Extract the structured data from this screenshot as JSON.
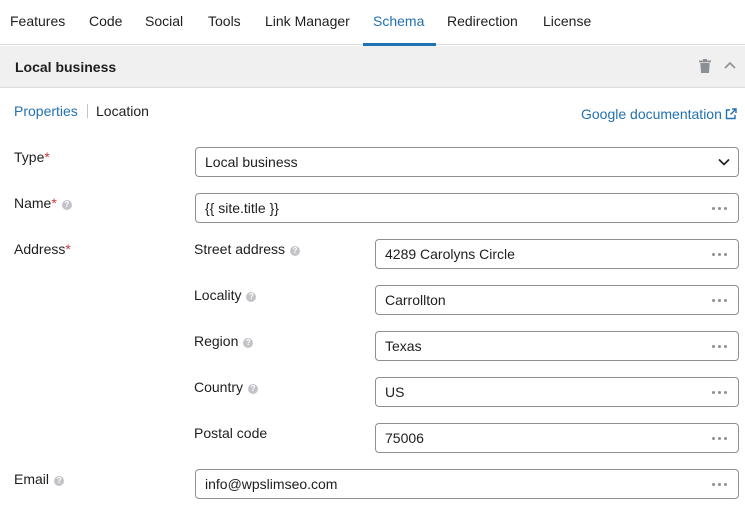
{
  "tabs": [
    "Features",
    "Code",
    "Social",
    "Tools",
    "Link Manager",
    "Schema",
    "Redirection",
    "License"
  ],
  "active_tab": "Schema",
  "panel": {
    "title": "Local business"
  },
  "subnav": {
    "properties": "Properties",
    "location": "Location",
    "google_doc": "Google documentation"
  },
  "form": {
    "type": {
      "label": "Type",
      "required": "*",
      "value": "Local business"
    },
    "name": {
      "label": "Name",
      "required": "*",
      "value": "{{ site.title }}"
    },
    "address": {
      "label": "Address",
      "required": "*",
      "street": {
        "label": "Street address",
        "value": "4289 Carolyns Circle"
      },
      "locality": {
        "label": "Locality",
        "value": "Carrollton"
      },
      "region": {
        "label": "Region",
        "value": "Texas"
      },
      "country": {
        "label": "Country",
        "value": "US"
      },
      "postal": {
        "label": "Postal code",
        "value": "75006"
      }
    },
    "email": {
      "label": "Email",
      "value": "info@wpslimseo.com"
    }
  },
  "colors": {
    "accent": "#2271b1",
    "required": "#d63638",
    "border": "#8c8f94",
    "header_bg": "#f0f0f1"
  }
}
